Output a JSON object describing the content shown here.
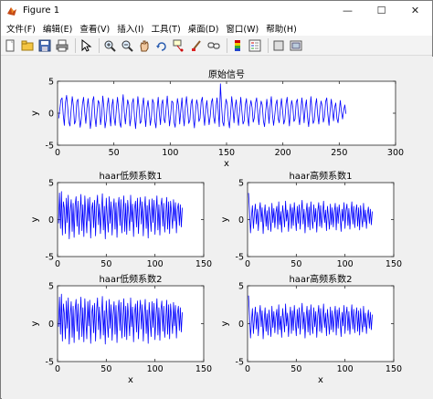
{
  "window": {
    "title": "Figure 1",
    "minimize": "—",
    "maximize": "☐",
    "close": "✕"
  },
  "menu": [
    "文件(F)",
    "编辑(E)",
    "查看(V)",
    "插入(I)",
    "工具(T)",
    "桌面(D)",
    "窗口(W)",
    "帮助(H)"
  ],
  "toolbar": [
    "new-figure-icon",
    "open-icon",
    "save-icon",
    "print-icon",
    "pointer-icon",
    "zoom-in-icon",
    "zoom-out-icon",
    "pan-icon",
    "rotate-icon",
    "data-cursor-icon",
    "brush-icon",
    "link-icon",
    "colorbar-icon",
    "legend-icon",
    "hide-plot-tools-icon",
    "show-plot-tools-icon"
  ],
  "colors": {
    "line": "#0000ff",
    "axes_bg": "#ffffff",
    "figure_bg": "#f0f0f0"
  },
  "chart_data": [
    {
      "type": "line",
      "title": "原始信号",
      "xlabel": "x",
      "ylabel": "y",
      "xlim": [
        0,
        300
      ],
      "ylim": [
        -5,
        5
      ],
      "xticks": [
        0,
        50,
        100,
        150,
        200,
        250,
        300
      ],
      "yticks": [
        -5,
        0,
        5
      ],
      "n": 256,
      "series": [
        {
          "values": [
            -0.8,
            0.6,
            2.1,
            2.4,
            -0.2,
            -1.9,
            1.7,
            2.8,
            0.9,
            -1.4,
            -2.0,
            0.5,
            2.6,
            1.2,
            -1.7,
            -1.2,
            1.8,
            2.2,
            -0.3,
            -2.2,
            -0.9,
            1.4,
            2.5,
            0.2,
            -1.6,
            0.8,
            2.3,
            0.4,
            -2.4,
            -1.0,
            1.9,
            2.6,
            -0.6,
            -2.1,
            0.3,
            2.0,
            1.5,
            -1.8,
            -0.4,
            2.7,
            0.9,
            -2.3,
            -1.1,
            1.3,
            2.4,
            -0.1,
            -2.0,
            1.1,
            2.2,
            -0.8,
            -1.9,
            0.7,
            2.5,
            0.6,
            -1.5,
            -2.2,
            1.0,
            2.9,
            0.2,
            -1.7,
            0.4,
            2.1,
            1.3,
            -2.0,
            -0.7,
            1.6,
            2.3,
            -0.5,
            -2.4,
            0.1,
            2.6,
            1.0,
            -1.6,
            -1.3,
            1.2,
            2.4,
            -0.2,
            -2.1,
            0.9,
            2.0,
            0.3,
            -1.9,
            -0.6,
            2.2,
            1.6,
            -1.2,
            -2.3,
            0.6,
            2.5,
            0.0,
            -1.8,
            1.4,
            2.1,
            -0.9,
            -1.5,
            0.8,
            2.7,
            0.4,
            -2.0,
            -0.3,
            1.9,
            1.7,
            -1.4,
            -2.2,
            0.2,
            2.3,
            1.1,
            -1.7,
            0.5,
            2.4,
            -0.4,
            -2.0,
            1.0,
            2.6,
            0.7,
            -1.6,
            -1.1,
            1.5,
            2.2,
            -0.7,
            -2.3,
            0.3,
            2.1,
            1.2,
            -1.3,
            -0.8,
            1.8,
            2.5,
            -0.1,
            -1.9,
            0.6,
            2.0,
            0.1,
            -1.8,
            -0.5,
            1.7,
            2.3,
            -0.6,
            -1.6,
            0.9,
            2.4,
            0.5,
            -2.1,
            4.6,
            1.2,
            -1.4,
            -2.0,
            0.7,
            2.2,
            1.4,
            -1.1,
            -2.3,
            0.0,
            2.6,
            0.8,
            -1.5,
            1.0,
            2.1,
            -0.3,
            -1.9,
            0.4,
            2.5,
            0.3,
            -1.7,
            -1.2,
            1.3,
            2.3,
            -0.5,
            -2.0,
            0.8,
            2.0,
            0.9,
            -1.4,
            -0.7,
            1.6,
            2.4,
            0.1,
            -1.8,
            0.5,
            1.9,
            1.3,
            -1.2,
            -2.1,
            0.2,
            2.2,
            0.6,
            -1.6,
            1.1,
            2.6,
            -0.2,
            -1.9,
            -0.4,
            1.4,
            2.1,
            -0.8,
            -1.5,
            0.7,
            2.3,
            0.4,
            -1.7,
            -1.0,
            1.5,
            2.5,
            0.0,
            -2.0,
            0.6,
            2.0,
            1.0,
            -1.3,
            -0.9,
            1.7,
            2.2,
            -0.4,
            -1.8,
            0.3,
            2.4,
            0.8,
            -1.5,
            0.9,
            2.1,
            -0.6,
            -2.1,
            0.1,
            2.6,
            0.5,
            -1.6,
            -1.1,
            1.2,
            2.3,
            -0.3,
            -1.7,
            0.7,
            1.9,
            1.1,
            -1.4,
            -0.6,
            1.8,
            2.4,
            -0.2,
            -1.9,
            0.4,
            2.2,
            0.6,
            -1.2,
            0.9,
            1.6,
            -0.8,
            -1.5,
            0.3,
            2.0,
            0.2,
            -0.9,
            0.5,
            1.3,
            -0.1
          ]
        }
      ]
    },
    {
      "type": "line",
      "title": "haar低频系数1",
      "xlabel": "",
      "ylabel": "y",
      "xlim": [
        0,
        150
      ],
      "ylim": [
        -5,
        5
      ],
      "xticks": [
        0,
        50,
        100,
        150
      ],
      "yticks": [
        -5,
        0,
        5
      ],
      "n": 128,
      "series": [
        {
          "values": [
            -0.5,
            3.6,
            -1.2,
            3.8,
            -2.1,
            2.4,
            1.5,
            -1.9,
            2.9,
            -0.4,
            3.3,
            -2.6,
            1.1,
            2.7,
            -1.6,
            2.2,
            -2.4,
            1.9,
            3.1,
            -0.9,
            2.5,
            -2.0,
            0.8,
            3.4,
            -1.5,
            2.0,
            -2.3,
            3.2,
            0.6,
            -1.8,
            2.8,
            -0.2,
            3.0,
            -2.5,
            1.4,
            2.3,
            -1.1,
            2.6,
            -2.2,
            1.7,
            3.3,
            -0.7,
            2.1,
            -1.9,
            0.9,
            3.5,
            -1.4,
            1.8,
            -2.6,
            2.9,
            0.4,
            -1.7,
            3.1,
            -0.5,
            2.4,
            -2.1,
            1.2,
            2.8,
            -1.3,
            2.3,
            -2.4,
            1.6,
            3.0,
            -0.8,
            2.7,
            -1.8,
            0.7,
            3.2,
            -1.6,
            2.2,
            -2.0,
            2.6,
            0.8,
            -1.5,
            3.3,
            -0.3,
            2.1,
            -2.3,
            1.5,
            2.5,
            -1.0,
            2.9,
            -1.9,
            1.3,
            3.0,
            -0.6,
            2.4,
            -2.2,
            1.0,
            3.1,
            -1.2,
            1.9,
            -2.5,
            2.7,
            0.5,
            -1.6,
            2.8,
            -0.4,
            2.6,
            -2.0,
            1.1,
            3.2,
            -1.4,
            2.0,
            -2.1,
            1.8,
            2.9,
            -0.9,
            2.2,
            -1.7,
            0.6,
            3.0,
            -1.3,
            2.4,
            -1.9,
            2.5,
            0.9,
            -1.2,
            2.7,
            -0.2,
            2.3,
            -1.8,
            1.4,
            2.2,
            -0.8,
            2.0,
            -1.0,
            1.6
          ]
        }
      ]
    },
    {
      "type": "line",
      "title": "haar高频系数1",
      "xlabel": "",
      "ylabel": "y",
      "xlim": [
        0,
        150
      ],
      "ylim": [
        -5,
        5
      ],
      "xticks": [
        0,
        50,
        100,
        150
      ],
      "yticks": [
        -5,
        0,
        5
      ],
      "n": 128,
      "series": [
        {
          "values": [
            3.6,
            1.2,
            -1.8,
            0.4,
            1.9,
            -1.2,
            0.8,
            2.1,
            -0.6,
            1.4,
            -1.5,
            1.0,
            2.3,
            -0.3,
            1.6,
            -1.9,
            0.5,
            2.0,
            -0.9,
            1.2,
            -1.4,
            1.7,
            0.2,
            -1.6,
            2.2,
            -0.4,
            1.5,
            -1.1,
            0.9,
            1.8,
            -1.3,
            2.4,
            -0.7,
            1.1,
            -1.7,
            1.9,
            0.6,
            -1.0,
            2.5,
            -0.2,
            1.3,
            -1.6,
            0.7,
            2.1,
            -1.2,
            1.6,
            -0.8,
            2.3,
            0.3,
            -1.5,
            1.8,
            -0.5,
            2.0,
            -1.3,
            1.0,
            2.6,
            -0.6,
            1.4,
            -1.8,
            0.8,
            2.2,
            -1.0,
            1.7,
            -1.4,
            2.4,
            0.1,
            -1.2,
            2.0,
            -0.3,
            1.5,
            -1.7,
            1.1,
            2.3,
            -0.9,
            1.9,
            -1.1,
            0.6,
            2.5,
            -0.4,
            1.3,
            -1.5,
            1.8,
            0.4,
            -1.3,
            2.1,
            -0.7,
            1.6,
            -1.0,
            0.9,
            2.2,
            -1.4,
            1.7,
            -0.5,
            2.0,
            0.5,
            -1.6,
            1.4,
            -0.2,
            2.3,
            -1.2,
            1.2,
            2.1,
            -0.8,
            1.5,
            -1.3,
            0.7,
            2.4,
            -0.6,
            1.8,
            -1.1,
            1.0,
            2.0,
            -0.9,
            1.6,
            -1.4,
            1.9,
            0.3,
            -1.0,
            2.2,
            -0.3,
            1.3,
            -1.2,
            0.8,
            1.7,
            -0.5,
            1.4,
            -0.7,
            1.1
          ]
        }
      ]
    },
    {
      "type": "line",
      "title": "haar低频系数2",
      "xlabel": "x",
      "ylabel": "y",
      "xlim": [
        0,
        150
      ],
      "ylim": [
        -5,
        5
      ],
      "xticks": [
        0,
        50,
        100,
        150
      ],
      "yticks": [
        -5,
        0,
        5
      ],
      "n": 128,
      "series": [
        {
          "values": [
            -0.4,
            3.5,
            -1.4,
            3.9,
            -2.3,
            2.6,
            1.3,
            -2.0,
            3.0,
            -0.6,
            3.4,
            -2.7,
            1.0,
            2.9,
            -1.8,
            2.3,
            -2.5,
            1.8,
            3.2,
            -1.0,
            2.6,
            -2.1,
            0.7,
            3.5,
            -1.7,
            2.1,
            -2.4,
            3.3,
            0.5,
            -2.0,
            2.9,
            -0.3,
            3.1,
            -2.6,
            1.3,
            2.4,
            -1.2,
            2.7,
            -2.3,
            1.6,
            3.4,
            -0.8,
            2.2,
            -2.0,
            0.8,
            3.6,
            -1.5,
            1.7,
            -2.7,
            3.0,
            0.3,
            -1.8,
            3.2,
            -0.6,
            2.5,
            -2.2,
            1.1,
            2.9,
            -1.4,
            2.4,
            -2.5,
            1.5,
            3.1,
            -0.9,
            2.8,
            -1.9,
            0.6,
            3.3,
            -1.7,
            2.3,
            -2.1,
            2.7,
            0.7,
            -1.6,
            3.4,
            -0.4,
            2.2,
            -2.4,
            1.4,
            2.6,
            -1.1,
            3.0,
            -2.0,
            1.2,
            3.1,
            -0.7,
            2.5,
            -2.3,
            0.9,
            3.2,
            -1.3,
            1.8,
            -2.6,
            2.8,
            0.4,
            -1.7,
            2.9,
            -0.5,
            2.7,
            -2.1,
            1.0,
            3.3,
            -1.5,
            2.1,
            -2.2,
            1.7,
            3.0,
            -1.0,
            2.3,
            -1.8,
            0.5,
            3.1,
            -1.4,
            2.5,
            -2.0,
            2.6,
            0.8,
            -1.3,
            2.8,
            -0.3,
            2.4,
            -1.9,
            1.3,
            2.3,
            -0.9,
            2.1,
            -1.1,
            1.5
          ]
        }
      ]
    },
    {
      "type": "line",
      "title": "haar高频系数2",
      "xlabel": "x",
      "ylabel": "y",
      "xlim": [
        0,
        150
      ],
      "ylim": [
        -5,
        5
      ],
      "xticks": [
        0,
        50,
        100,
        150
      ],
      "yticks": [
        -5,
        0,
        5
      ],
      "n": 128,
      "series": [
        {
          "values": [
            3.7,
            1.1,
            -1.9,
            0.3,
            2.0,
            -1.3,
            0.7,
            2.2,
            -0.7,
            1.5,
            -1.6,
            0.9,
            2.4,
            -0.4,
            1.7,
            -2.0,
            0.4,
            2.1,
            -1.0,
            1.3,
            -1.5,
            1.8,
            0.1,
            -1.7,
            2.3,
            -0.5,
            1.6,
            -1.2,
            0.8,
            1.9,
            -1.4,
            2.5,
            -0.8,
            1.0,
            -1.8,
            2.0,
            0.5,
            -1.1,
            2.6,
            -0.3,
            1.4,
            -1.7,
            0.6,
            2.2,
            -1.3,
            1.7,
            -0.9,
            2.4,
            0.2,
            -1.6,
            1.9,
            -0.6,
            2.1,
            -1.4,
            0.9,
            2.7,
            -0.7,
            1.5,
            -1.9,
            0.7,
            2.3,
            -1.1,
            1.8,
            -1.5,
            2.5,
            0.0,
            -1.3,
            2.1,
            -0.4,
            1.6,
            -1.8,
            1.0,
            2.4,
            -1.0,
            2.0,
            -1.2,
            0.5,
            2.6,
            -0.5,
            1.4,
            -1.6,
            1.9,
            0.3,
            -1.4,
            2.2,
            -0.8,
            1.7,
            -1.1,
            0.8,
            2.3,
            -1.5,
            1.8,
            -0.6,
            2.1,
            0.4,
            -1.7,
            1.5,
            -0.3,
            2.4,
            -1.3,
            1.1,
            2.2,
            -0.9,
            1.6,
            -1.4,
            0.6,
            2.5,
            -0.7,
            1.9,
            -1.2,
            0.9,
            2.1,
            -1.0,
            1.7,
            -1.5,
            2.0,
            0.2,
            -1.1,
            2.3,
            -0.4,
            1.4,
            -1.3,
            0.7,
            1.8,
            -0.6,
            1.5,
            -0.8,
            1.2
          ]
        }
      ]
    }
  ]
}
